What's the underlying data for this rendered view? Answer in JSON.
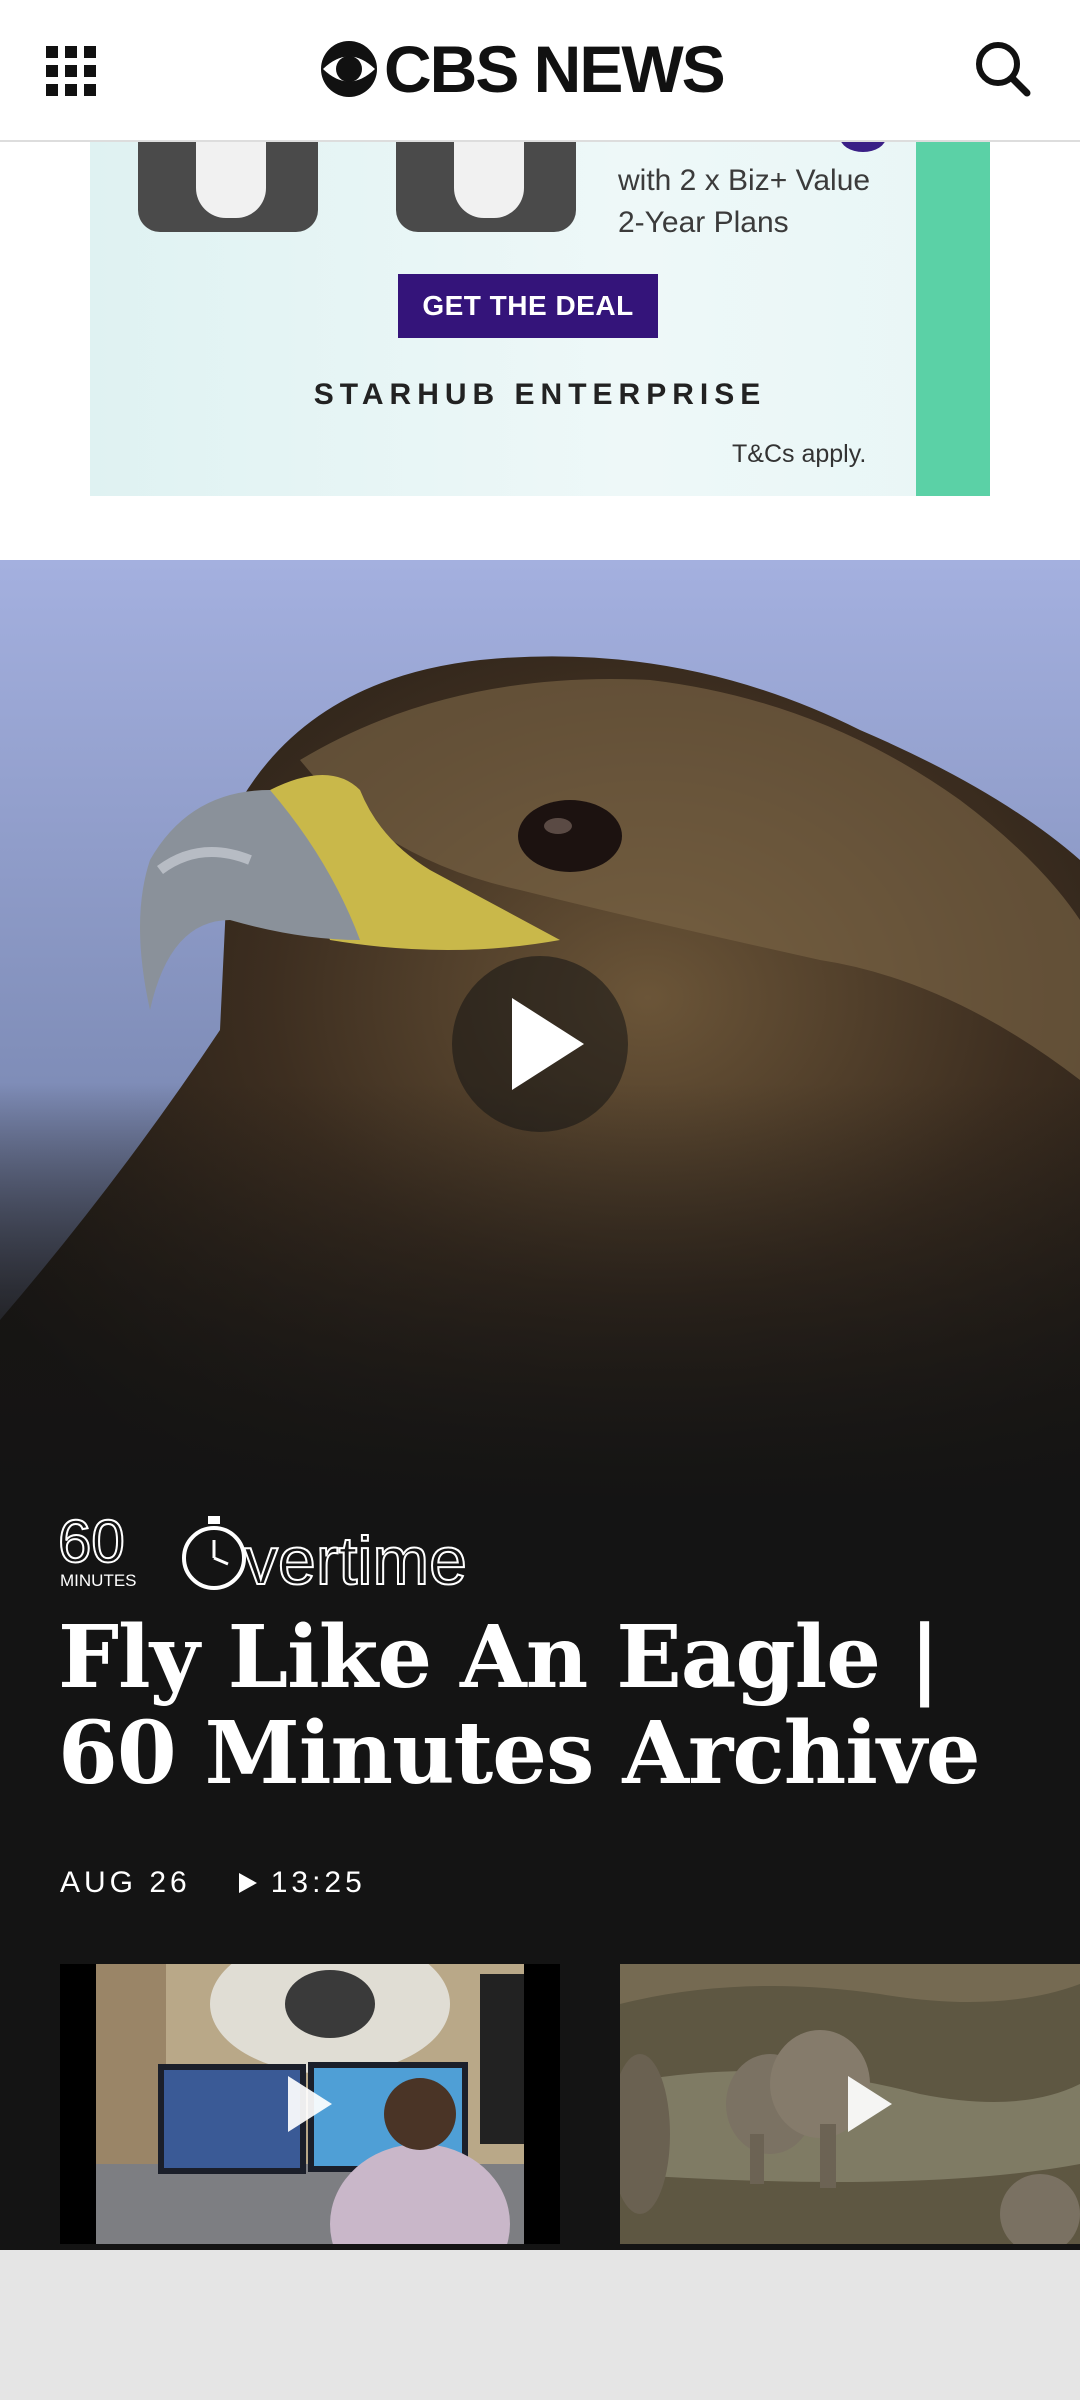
{
  "header": {
    "logo_text": "CBS NEWS",
    "menu_icon": "grid-menu-icon",
    "search_icon": "search-icon"
  },
  "ad": {
    "line1": "with 2 x Biz+ Value",
    "line2": "2-Year Plans",
    "cta": "GET THE DEAL",
    "brand": "STARHUB ENTERPRISE",
    "terms": "T&Cs apply.",
    "colors": {
      "cta_bg": "#34147a",
      "stripe": "#5bd1a6"
    }
  },
  "featured": {
    "show_logo": "60 MINUTES Overtime",
    "headline": "Fly Like An Eagle | 60 Minutes Archive",
    "date": "AUG 26",
    "duration": "13:25"
  },
  "thumbnails": [
    {
      "name": "mri-lab-video",
      "icon": "play-icon"
    },
    {
      "name": "elephants-video",
      "icon": "play-icon"
    }
  ]
}
